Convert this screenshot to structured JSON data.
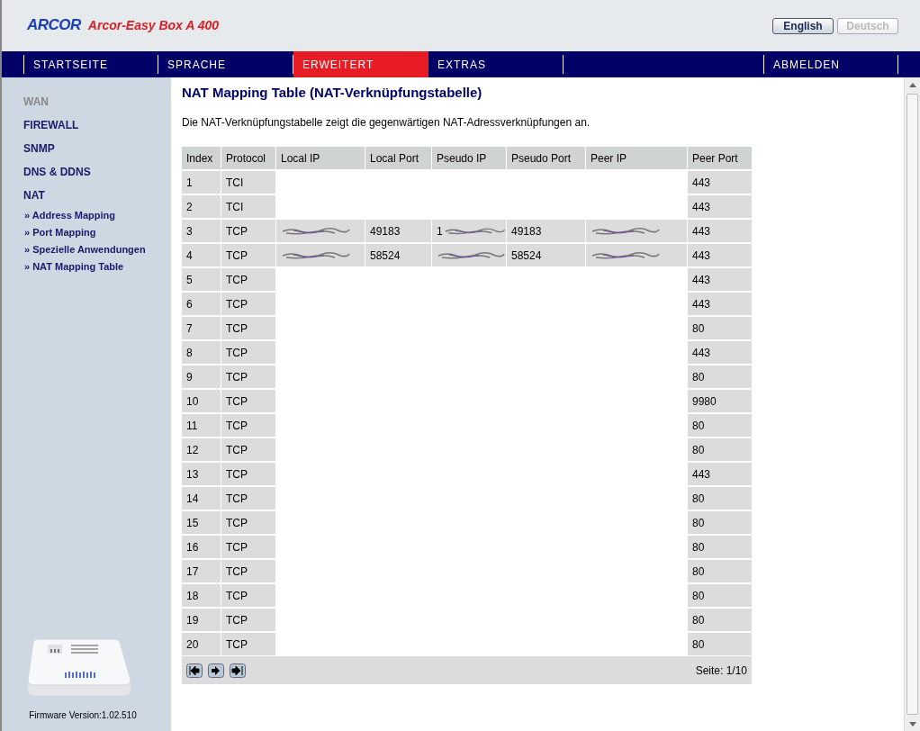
{
  "header": {
    "logo": "ARCOR",
    "product": "Arcor-Easy Box A 400",
    "languages": [
      {
        "label": "English",
        "selected": true
      },
      {
        "label": "Deutsch",
        "selected": false
      }
    ]
  },
  "nav": [
    {
      "label": "STARTSEITE",
      "selected": false
    },
    {
      "label": "SPRACHE",
      "selected": false
    },
    {
      "label": "ERWEITERT",
      "selected": true
    },
    {
      "label": "EXTRAS",
      "selected": false
    },
    {
      "label": "ABMELDEN",
      "selected": false
    }
  ],
  "sidebar": {
    "items": [
      {
        "label": "WAN",
        "kind": "section",
        "disabled": true
      },
      {
        "label": "FIREWALL",
        "kind": "section",
        "disabled": false
      },
      {
        "label": "SNMP",
        "kind": "section",
        "disabled": false
      },
      {
        "label": "DNS & DDNS",
        "kind": "section",
        "disabled": false
      },
      {
        "label": "NAT",
        "kind": "section",
        "disabled": false
      },
      {
        "label": "» Address Mapping",
        "kind": "sub",
        "disabled": false
      },
      {
        "label": "» Port Mapping",
        "kind": "sub",
        "disabled": false
      },
      {
        "label": "» Spezielle Anwendungen",
        "kind": "sub",
        "disabled": false
      },
      {
        "label": "» NAT Mapping Table",
        "kind": "sub",
        "disabled": false
      }
    ],
    "firmware": "Firmware Version:1.02.510"
  },
  "page": {
    "title": "NAT Mapping Table (NAT-Verknüpfungstabelle)",
    "description": "Die NAT-Verknüpfungstabelle zeigt die gegenwärtigen NAT-Adressverknüpfungen an."
  },
  "table": {
    "columns": [
      "Index",
      "Protocol",
      "Local IP",
      "Local Port",
      "Pseudo IP",
      "Pseudo Port",
      "Peer IP",
      "Peer Port"
    ],
    "rows": [
      {
        "index": "1",
        "protocol": "TCI",
        "kind": "full",
        "peer_port": "443"
      },
      {
        "index": "2",
        "protocol": "TCI",
        "kind": "full",
        "peer_port": "443"
      },
      {
        "index": "3",
        "protocol": "TCP",
        "kind": "scribble",
        "local_port": "49183",
        "pseudo_ip": "1",
        "pseudo_port": "49183",
        "peer_port": "443"
      },
      {
        "index": "4",
        "protocol": "TCP",
        "kind": "scribble",
        "local_port": "58524",
        "pseudo_port": "58524",
        "peer_port": "443"
      },
      {
        "index": "5",
        "protocol": "TCP",
        "kind": "full",
        "peer_port": "443"
      },
      {
        "index": "6",
        "protocol": "TCP",
        "kind": "full",
        "peer_port": "443"
      },
      {
        "index": "7",
        "protocol": "TCP",
        "kind": "full",
        "peer_port": "80"
      },
      {
        "index": "8",
        "protocol": "TCP",
        "kind": "full",
        "peer_port": "443"
      },
      {
        "index": "9",
        "protocol": "TCP",
        "kind": "full",
        "peer_port": "80"
      },
      {
        "index": "10",
        "protocol": "TCP",
        "kind": "full",
        "peer_port": "9980"
      },
      {
        "index": "11",
        "protocol": "TCP",
        "kind": "full",
        "peer_port": "80"
      },
      {
        "index": "12",
        "protocol": "TCP",
        "kind": "full",
        "peer_port": "80"
      },
      {
        "index": "13",
        "protocol": "TCP",
        "kind": "full",
        "peer_port": "443"
      },
      {
        "index": "14",
        "protocol": "TCP",
        "kind": "full",
        "peer_port": "80"
      },
      {
        "index": "15",
        "protocol": "TCP",
        "kind": "full",
        "peer_port": "80"
      },
      {
        "index": "16",
        "protocol": "TCP",
        "kind": "full",
        "peer_port": "80"
      },
      {
        "index": "17",
        "protocol": "TCP",
        "kind": "full",
        "peer_port": "80"
      },
      {
        "index": "18",
        "protocol": "TCP",
        "kind": "full",
        "peer_port": "80"
      },
      {
        "index": "19",
        "protocol": "TCP",
        "kind": "full",
        "peer_port": "80"
      },
      {
        "index": "20",
        "protocol": "TCP",
        "kind": "full",
        "peer_port": "80"
      }
    ],
    "page_info": "Seite: 1/10"
  }
}
